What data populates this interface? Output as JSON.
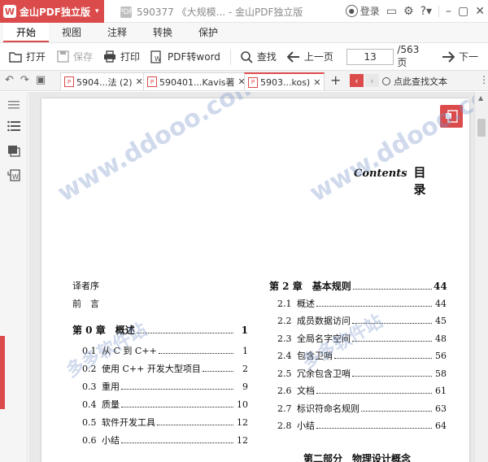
{
  "app": {
    "name": "金山PDF独立版",
    "doc_title": "590377 《大规模... - 金山PDF独立版",
    "pdf_badge": "PDF"
  },
  "titlebar_right": {
    "login": "登录",
    "help": "?",
    "dropdown": "▾"
  },
  "menu_tabs": [
    "开始",
    "视图",
    "注释",
    "转换",
    "保护"
  ],
  "toolbar": {
    "open": "打开",
    "save": "保存",
    "print": "打印",
    "pdf_to_word": "PDF转word",
    "find": "查找",
    "prev_page": "上一页",
    "current_page": "13",
    "total_pages": "/563 页",
    "next_page": "下一"
  },
  "doc_tabs": [
    {
      "label": "5904...法 (2)"
    },
    {
      "label": "590401...Kavis著"
    },
    {
      "label": "5903...kos)"
    }
  ],
  "find_text": "点此查找文本",
  "page": {
    "contents_script": "Contents",
    "contents_title": "目 录",
    "left_column": [
      {
        "num": "",
        "text": "译者序",
        "page": "",
        "kind": "front"
      },
      {
        "num": "",
        "text": "前　言",
        "page": "",
        "kind": "front"
      },
      {
        "num": "",
        "text": "第 0 章　概述",
        "page": "1",
        "kind": "chapter"
      },
      {
        "num": "0.1",
        "text": "从 C 到 C++",
        "page": "1",
        "kind": "section"
      },
      {
        "num": "0.2",
        "text": "使用 C++ 开发大型项目",
        "page": "2",
        "kind": "section"
      },
      {
        "num": "0.3",
        "text": "重用",
        "page": "9",
        "kind": "section"
      },
      {
        "num": "0.4",
        "text": "质量",
        "page": "10",
        "kind": "section"
      },
      {
        "num": "0.5",
        "text": "软件开发工具",
        "page": "12",
        "kind": "section"
      },
      {
        "num": "0.6",
        "text": "小结",
        "page": "12",
        "kind": "section"
      }
    ],
    "right_column": [
      {
        "num": "",
        "text": "第 2 章　基本规则",
        "page": "44",
        "kind": "chapter"
      },
      {
        "num": "2.1",
        "text": "概述",
        "page": "44",
        "kind": "section"
      },
      {
        "num": "2.2",
        "text": "成员数据访问",
        "page": "45",
        "kind": "section"
      },
      {
        "num": "2.3",
        "text": "全局名字空间",
        "page": "48",
        "kind": "section"
      },
      {
        "num": "2.4",
        "text": "包含卫哨",
        "page": "56",
        "kind": "section"
      },
      {
        "num": "2.5",
        "text": "冗余包含卫哨",
        "page": "58",
        "kind": "section"
      },
      {
        "num": "2.6",
        "text": "文档",
        "page": "61",
        "kind": "section"
      },
      {
        "num": "2.7",
        "text": "标识符命名规则",
        "page": "63",
        "kind": "section"
      },
      {
        "num": "2.8",
        "text": "小结",
        "page": "64",
        "kind": "section"
      }
    ],
    "part_title": "第二部分　物理设计概念"
  },
  "watermark": [
    "www.ddooo.com",
    "多多软件站"
  ],
  "colors": {
    "accent": "#dc4b4b",
    "watermark": "#7896c8"
  }
}
